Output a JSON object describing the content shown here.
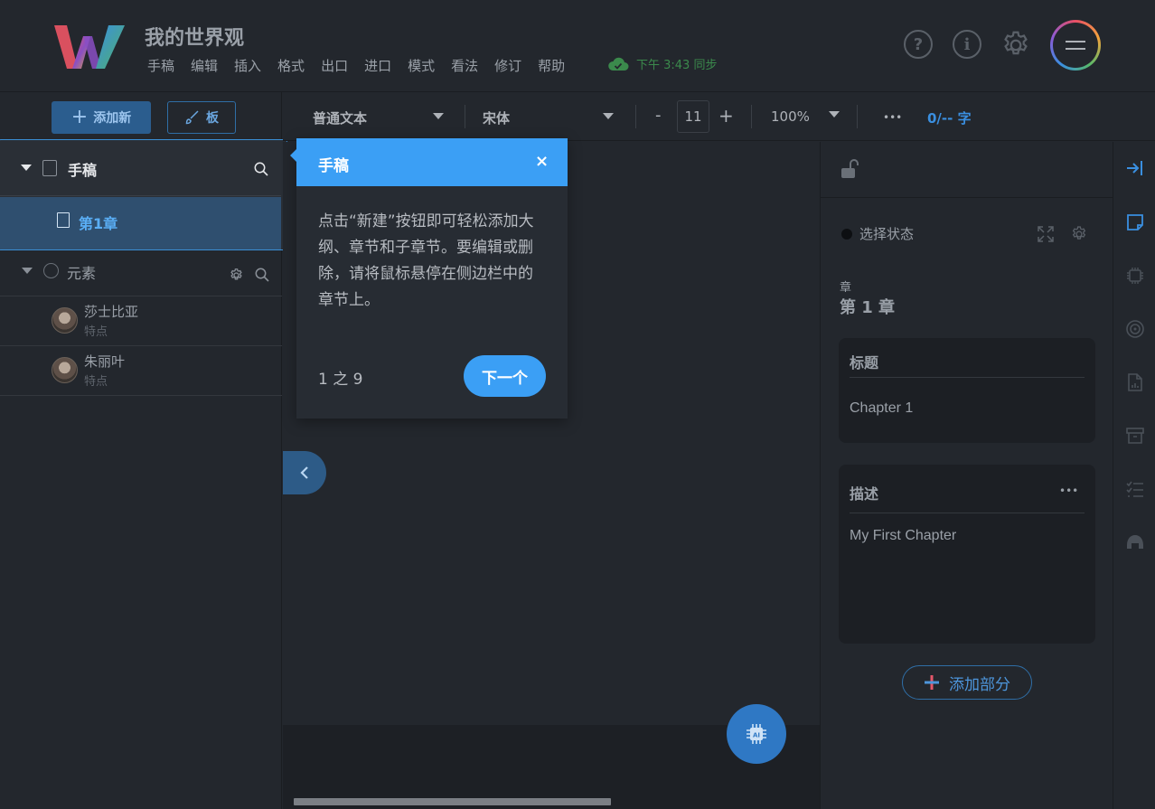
{
  "app": {
    "title": "我的世界观"
  },
  "menu": [
    "手稿",
    "编辑",
    "插入",
    "格式",
    "出口",
    "进口",
    "模式",
    "看法",
    "修订",
    "帮助"
  ],
  "sync": {
    "text": "下午 3:43 同步"
  },
  "header_icons": [
    "help-icon",
    "info-icon",
    "gear-icon",
    "hamburger-menu-icon"
  ],
  "sidebar": {
    "add_new_label": "添加新",
    "board_label": "板",
    "manuscript": {
      "title": "手稿",
      "chapters": [
        "第1章"
      ]
    },
    "elements": {
      "title": "元素",
      "items": [
        {
          "name": "莎士比亚",
          "subtitle": "特点"
        },
        {
          "name": "朱丽叶",
          "subtitle": "特点"
        }
      ]
    }
  },
  "toolbar": {
    "style_select": "普通文本",
    "font_select": "宋体",
    "minus": "-",
    "font_size": "11",
    "plus": "+",
    "zoom": "100%",
    "more": "•••",
    "word_count": "0/-- 字"
  },
  "tour": {
    "title": "手稿",
    "close": "×",
    "body": "点击“新建”按钮即可轻松添加大纲、章节和子章节。要编辑或删除，请将鼠标悬停在侧边栏中的章节上。",
    "step": "1 之 9",
    "next_label": "下一个"
  },
  "right_panel": {
    "status_text": "选择状态",
    "chapter_caption": "章",
    "chapter_name": "第 1 章",
    "title_card": {
      "label": "标题",
      "value": "Chapter 1"
    },
    "desc_card": {
      "label": "描述",
      "more": "•••",
      "value": "My First Chapter"
    },
    "add_section_label": "添加部分"
  },
  "rail_icons": [
    "collapse-panel-icon",
    "notes-icon",
    "ai-chip-icon",
    "target-icon",
    "doc-stats-icon",
    "archive-icon",
    "checklist-icon",
    "helmet-icon"
  ],
  "colors": {
    "accent": "#3b9ff5",
    "bg": "#23272d",
    "sync_green": "#3b8a4c"
  }
}
